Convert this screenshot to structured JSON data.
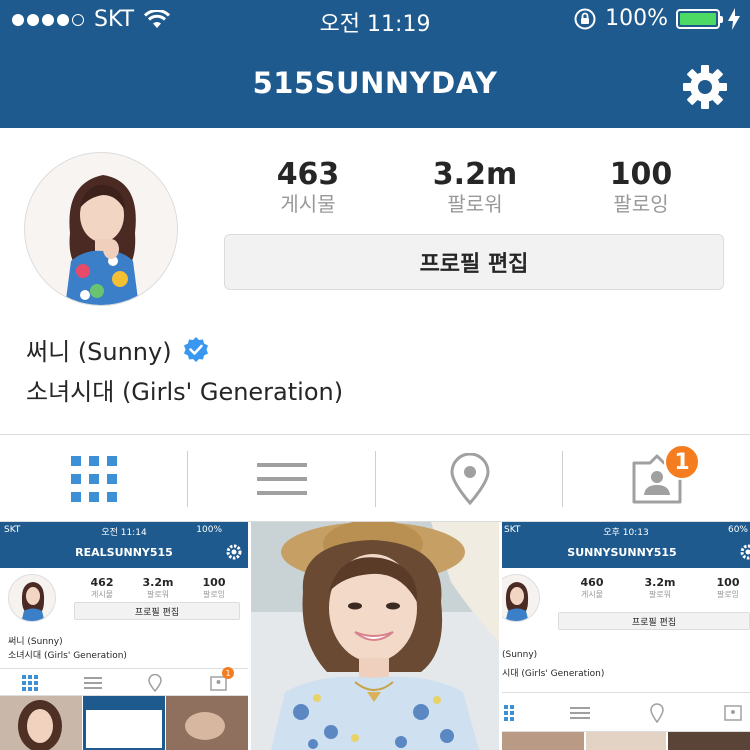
{
  "status_bar": {
    "carrier": "SKT",
    "time": "오전 11:19",
    "battery": "100%"
  },
  "header": {
    "username": "515SUNNYDAY"
  },
  "colors": {
    "brand": "#1e5a8e",
    "verified": "#3897f0",
    "badge": "#f57c1f",
    "battery": "#4cd964"
  },
  "profile": {
    "stats": [
      {
        "value": "463",
        "label": "게시물"
      },
      {
        "value": "3.2m",
        "label": "팔로워"
      },
      {
        "value": "100",
        "label": "팔로잉"
      }
    ],
    "edit_button": "프로필 편집",
    "name": "써니 (Sunny)",
    "bio": "소녀시대 (Girls' Generation)"
  },
  "tabs": [
    {
      "icon": "grid-icon",
      "active": true
    },
    {
      "icon": "list-icon",
      "active": false
    },
    {
      "icon": "location-pin-icon",
      "active": false
    },
    {
      "icon": "tagged-person-icon",
      "active": false,
      "badge": "1"
    }
  ],
  "posts": [
    {
      "status": {
        "carrier": "SKT",
        "time": "오전 11:14",
        "battery": "100%"
      },
      "username": "REALSUNNY515",
      "stats": [
        {
          "value": "462",
          "label": "게시물"
        },
        {
          "value": "3.2m",
          "label": "팔로워"
        },
        {
          "value": "100",
          "label": "팔로잉"
        }
      ],
      "edit_button": "프로필 편집",
      "name": "써니 (Sunny)",
      "bio": "소녀시대 (Girls' Generation)",
      "badge": "1"
    },
    {
      "type": "photo"
    },
    {
      "status": {
        "carrier": "SKT",
        "time": "오후 10:13",
        "battery": "60%"
      },
      "username": "SUNNYSUNNY515",
      "stats": [
        {
          "value": "460",
          "label": "게시물"
        },
        {
          "value": "3.2m",
          "label": "팔로워"
        },
        {
          "value": "100",
          "label": "팔로잉"
        }
      ],
      "edit_button": "프로필 편집",
      "name": "(Sunny)",
      "bio": "시대 (Girls' Generation)"
    }
  ]
}
